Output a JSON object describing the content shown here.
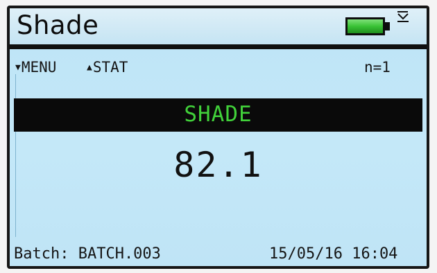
{
  "header": {
    "title": "Shade",
    "battery_icon": "battery-full-icon",
    "usb_icon": "usb-icon",
    "usb_glyph": "⏷",
    "battery_color": "#39c235"
  },
  "nav": {
    "menu_arrow": "▼",
    "menu_label": "MENU",
    "stat_arrow": "▲",
    "stat_label": "STAT",
    "count": "n=1"
  },
  "reading": {
    "label": "SHADE",
    "value": "82.1",
    "label_color": "#41d13a"
  },
  "footer": {
    "batch": "Batch: BATCH.003",
    "datetime": "15/05/16 16:04"
  }
}
